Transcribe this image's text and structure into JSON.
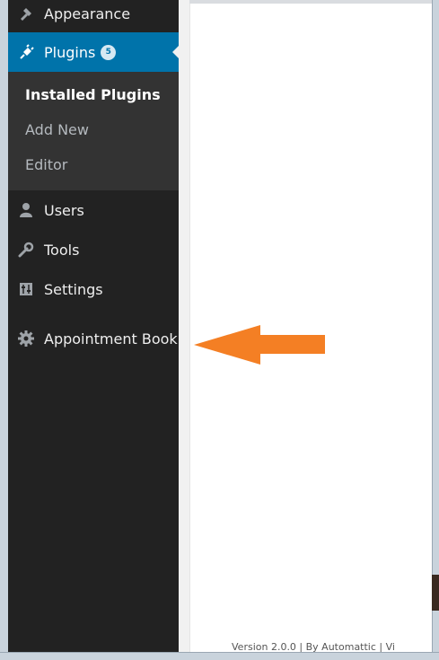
{
  "menu": {
    "appearance": {
      "label": "Appearance",
      "icon": "brush-icon"
    },
    "plugins": {
      "label": "Plugins",
      "badge": "5",
      "icon": "plug-icon"
    },
    "plugins_submenu": [
      "Installed Plugins",
      "Add New",
      "Editor"
    ],
    "users": {
      "label": "Users",
      "icon": "user-icon"
    },
    "tools": {
      "label": "Tools",
      "icon": "wrench-icon"
    },
    "settings": {
      "label": "Settings",
      "icon": "settings-sliders-icon"
    },
    "appointment_book": {
      "label": "Appointment Book",
      "icon": "gear-icon"
    }
  },
  "footer": {
    "version_text": "Version 2.0.0 | By Automattic | Vi"
  },
  "colors": {
    "active_menu": "#0073aa",
    "sidebar": "#222222",
    "arrow": "#f47f24"
  }
}
